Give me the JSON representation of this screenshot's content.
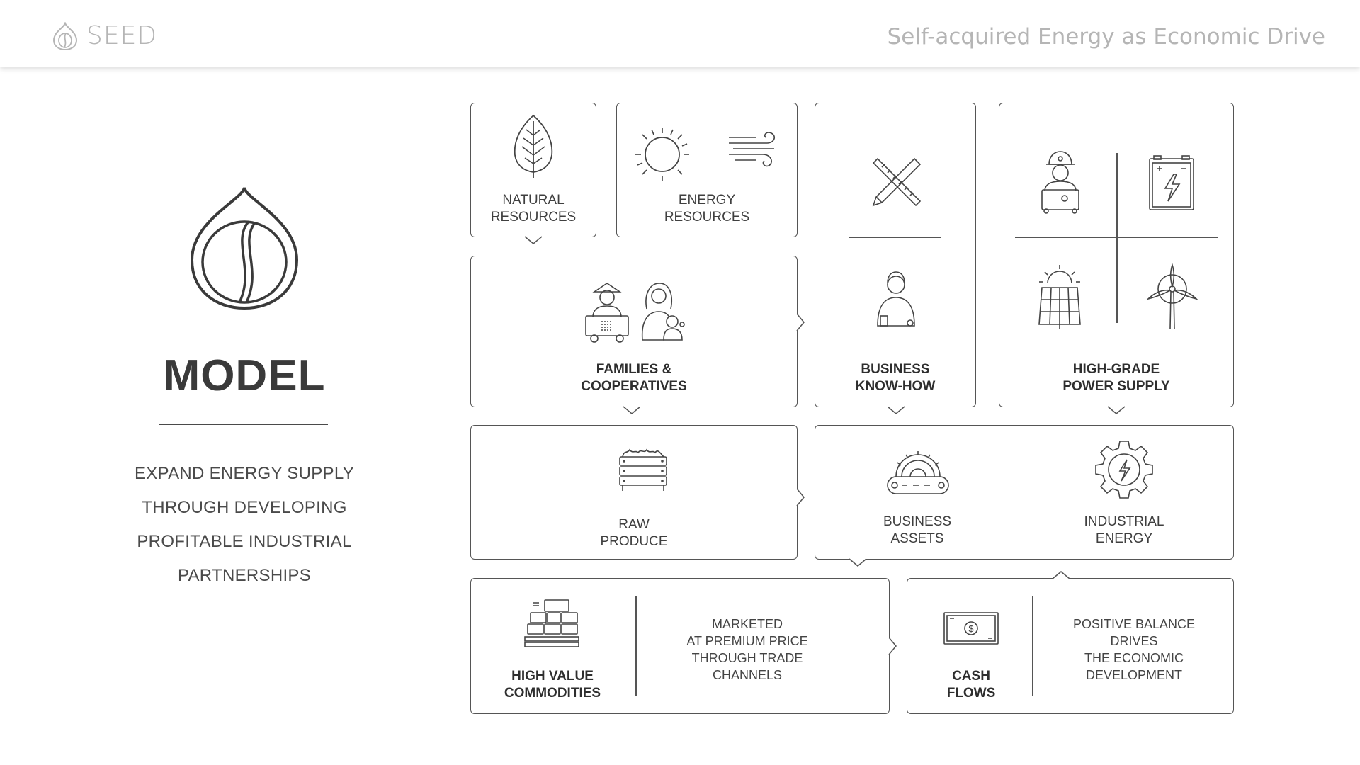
{
  "header": {
    "brand_name": "SEED",
    "tagline": "Self-acquired Energy as Economic Drive"
  },
  "model": {
    "title": "MODEL",
    "description_lines": [
      "EXPAND ENERGY SUPPLY",
      "THROUGH DEVELOPING",
      "PROFITABLE INDUSTRIAL",
      "PARTNERSHIPS"
    ]
  },
  "cards": {
    "natural_resources": [
      "NATURAL",
      "RESOURCES"
    ],
    "energy_resources": [
      "ENERGY",
      "RESOURCES"
    ],
    "families": [
      "FAMILIES &",
      "COOPERATIVES"
    ],
    "business_know_how": [
      "BUSINESS",
      "KNOW-HOW"
    ],
    "high_grade_power": [
      "HIGH-GRADE",
      "POWER SUPPLY"
    ],
    "raw_produce": [
      "RAW",
      "PRODUCE"
    ],
    "business_assets": [
      "BUSINESS",
      "ASSETS"
    ],
    "industrial_energy": [
      "INDUSTRIAL",
      "ENERGY"
    ],
    "high_value": {
      "label": [
        "HIGH VALUE",
        "COMMODITIES"
      ],
      "description": [
        "MARKETED",
        "AT PREMIUM PRICE",
        "THROUGH TRADE",
        "CHANNELS"
      ]
    },
    "cash_flows": {
      "label": [
        "CASH",
        "FLOWS"
      ],
      "description": [
        "POSITIVE BALANCE",
        "DRIVES",
        "THE ECONOMIC",
        "DEVELOPMENT"
      ]
    }
  },
  "icons": [
    "seed-logo-icon",
    "seed-drop-icon",
    "leaf-icon",
    "sun-icon",
    "wind-icon",
    "farmer-icon",
    "mother-child-icon",
    "tools-icon",
    "businessman-icon",
    "engineer-icon",
    "battery-icon",
    "solar-panel-icon",
    "wind-turbine-icon",
    "crate-icon",
    "conveyor-gear-icon",
    "energy-gear-icon",
    "boxes-icon",
    "cash-icon"
  ],
  "colors": {
    "line": "#555555",
    "text": "#3a3a3a",
    "header_text": "#b5b5b5"
  }
}
